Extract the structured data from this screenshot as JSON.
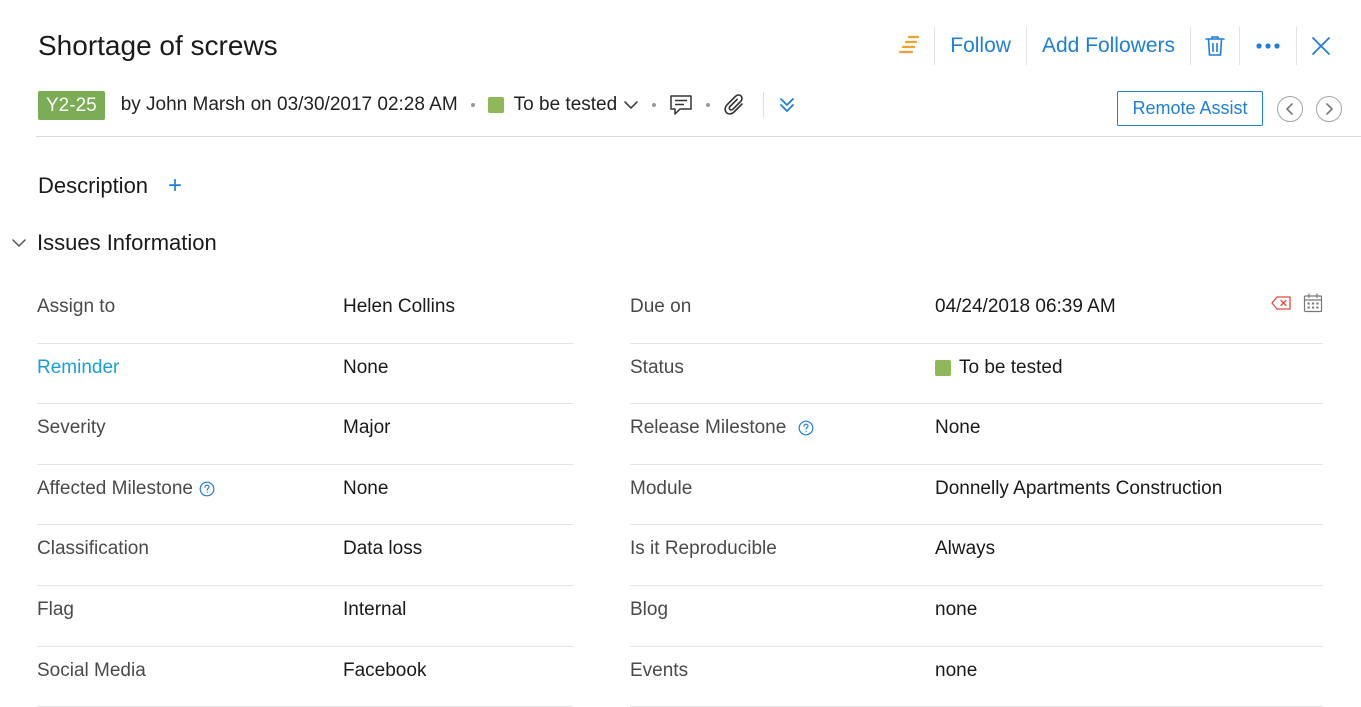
{
  "issue": {
    "title": "Shortage of screws",
    "id": "Y2-25",
    "byline": "by John Marsh on 03/30/2017 02:28 AM",
    "status": "To be tested"
  },
  "toolbar": {
    "follow": "Follow",
    "add_followers": "Add Followers",
    "remote_assist": "Remote Assist"
  },
  "sections": {
    "description": "Description",
    "issues_information": "Issues Information"
  },
  "colors": {
    "accent": "#1e7fd9",
    "tag_green": "#7aad56",
    "status_green": "#8fb659",
    "priority_orange": "#f0a030",
    "clear_red": "#e04a3a"
  },
  "fields_left": [
    {
      "label": "Assign to",
      "value": "Helen Collins"
    },
    {
      "label": "Reminder",
      "value": "None"
    },
    {
      "label": "Severity",
      "value": "Major"
    },
    {
      "label": "Affected Milestone",
      "value": "None"
    },
    {
      "label": "Classification",
      "value": "Data loss"
    },
    {
      "label": "Flag",
      "value": "Internal"
    },
    {
      "label": "Social Media",
      "value": "Facebook"
    }
  ],
  "fields_right": [
    {
      "label": "Due on",
      "value": "04/24/2018 06:39 AM"
    },
    {
      "label": "Status",
      "value": "To be tested"
    },
    {
      "label": "Release Milestone",
      "value": "None"
    },
    {
      "label": "Module",
      "value": "Donnelly Apartments Construction"
    },
    {
      "label": "Is it Reproducible",
      "value": "Always"
    },
    {
      "label": "Blog",
      "value": "none"
    },
    {
      "label": "Events",
      "value": "none"
    }
  ],
  "icons": {
    "priority": "priority-lines-icon",
    "delete": "trash-icon",
    "more": "more-dots-icon",
    "close": "close-icon",
    "comment": "comment-icon",
    "attach": "paperclip-icon",
    "expand": "double-chevron-down-icon",
    "help": "help-circle-icon",
    "clear": "clear-icon",
    "calendar": "calendar-icon"
  }
}
